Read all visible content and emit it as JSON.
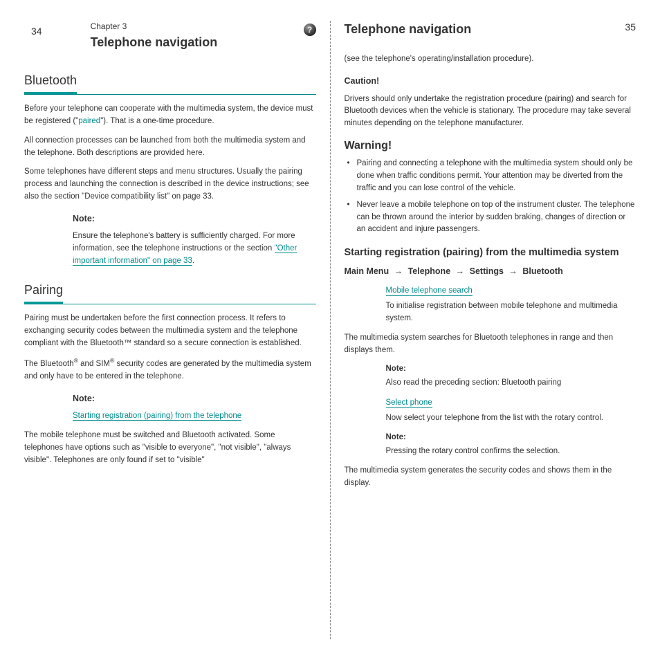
{
  "left": {
    "page_number": "34",
    "chapter_number": "Chapter 3",
    "chapter_title": "Telephone navigation",
    "help_icon_text": "?",
    "sections": [
      {
        "title": "Bluetooth",
        "p1_a": "Before your telephone can cooperate with the multimedia system, the device must be registered (\"",
        "p1_b": "\"). That is a one-time procedure.",
        "p2": "All connection processes can be launched from both the multimedia system and the telephone. Both descriptions are provided here.",
        "p3_a": "Some telephones have different steps and menu structures. Usually the pairing process and launching the connection is described in the device instructions; see also the section \"",
        "p3_link": "Device compatibility list",
        "p3_b": "\" on page 33.",
        "note": "Note:",
        "note_text_a": "Ensure the telephone's battery is sufficiently charged. For more information, see the telephone instructions or the section ",
        "note_link": "\"Other important information\" on page 33",
        "note_text_b": ".",
        "paired_link": "paired"
      },
      {
        "title": "Pairing",
        "p1": "Pairing must be undertaken before the first connection process. It refers to exchanging security codes between the multimedia system and the telephone compliant with the Bluetooth™ standard so a secure connection is established.",
        "p2_a": "The Bluetooth",
        "p2_b": " and SIM",
        "p2_c": " security codes are generated by the multimedia system and only have to be entered in the telephone.",
        "note": "Note:",
        "note_link": "Starting registration (pairing) from the telephone",
        "note_text": " ",
        "p3": "The mobile telephone must be switched and Bluetooth activated. Some telephones have options such as \"visible to everyone\", \"not visible\", \"always visible\". Telephones are only found if set to \"visible\""
      }
    ]
  },
  "right": {
    "page_number": "35",
    "chapter_title": "Telephone navigation",
    "p1": "(see the telephone's operating/installation procedure).",
    "caution_title": "Caution!",
    "caution_text": "Drivers should only undertake the registration procedure (pairing) and search for Bluetooth devices when the vehicle is stationary. The procedure may take several minutes depending on the telephone manufacturer.",
    "warning_title": "Warning!",
    "bullets": [
      "Pairing and connecting a telephone with the multimedia system should only be done when traffic conditions permit. Your attention may be diverted from the traffic and you can lose control of the vehicle.",
      "Never leave a mobile telephone on top of the instrument cluster. The telephone can be thrown around the interior by sudden braking, changes of direction or an accident and injure passengers."
    ],
    "section_title": "Starting registration (pairing) from the multimedia system",
    "breadcrumb": {
      "parts": [
        "Main Menu",
        "Telephone",
        "Settings",
        "Bluetooth"
      ],
      "sep": "→"
    },
    "menu_items": [
      {
        "link": "Mobile telephone search",
        "desc": "To initialise registration between mobile telephone and multimedia system.",
        "extra": "The multimedia system searches for Bluetooth telephones in range and then displays them.",
        "note_label": "Note:",
        "note_text": "Also read the preceding section: Bluetooth pairing"
      },
      {
        "link": "Select phone",
        "desc": "Now select your telephone from the list with the rotary control.",
        "extra": "",
        "note_label": "Note:",
        "note_text": "Pressing the rotary control confirms the selection."
      }
    ],
    "final": "The multimedia system generates the security codes and shows them in the display."
  }
}
